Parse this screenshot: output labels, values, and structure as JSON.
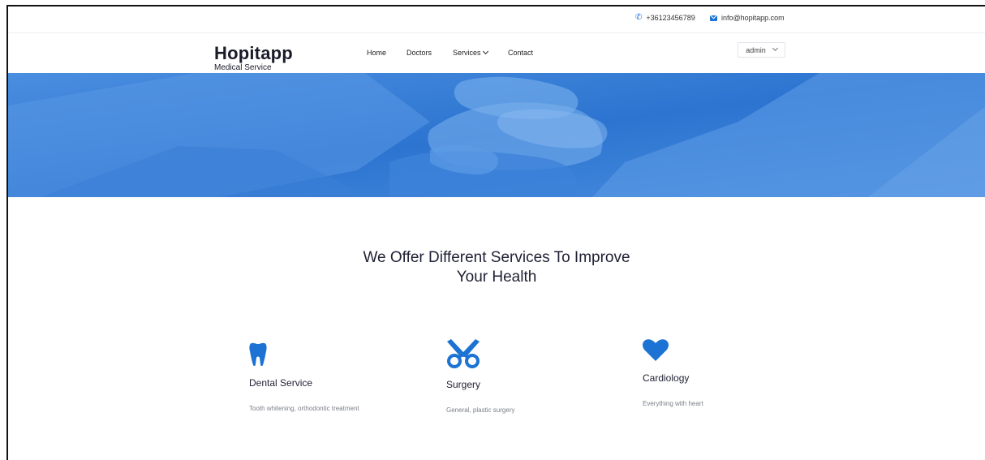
{
  "topbar": {
    "phone": "+36123456789",
    "email": "info@hopitapp.com",
    "phone_icon": "phone-icon",
    "email_icon": "envelope-icon"
  },
  "brand": {
    "title": "Hopitapp",
    "subtitle": "Medical Service"
  },
  "nav": {
    "items": [
      {
        "label": "Home"
      },
      {
        "label": "Doctors"
      },
      {
        "label": "Services"
      },
      {
        "label": "Contact"
      }
    ],
    "user": "admin"
  },
  "hero": {
    "background_color": "#2f78d3",
    "image": "stacked-hands-photo"
  },
  "services": {
    "title_line1": "We Offer Different Services To Improve",
    "title_line2": "Your Health",
    "items": [
      {
        "name": "Dental Service",
        "description": "Tooth whitening, orthodontic treatment",
        "icon": "tooth-icon"
      },
      {
        "name": "Surgery",
        "description": "General, plastic surgery",
        "icon": "scissors-icon"
      },
      {
        "name": "Cardiology",
        "description": "Everything with heart",
        "icon": "heart-icon"
      }
    ]
  },
  "colors": {
    "accent": "#1c73d4",
    "text": "#1f2033"
  }
}
